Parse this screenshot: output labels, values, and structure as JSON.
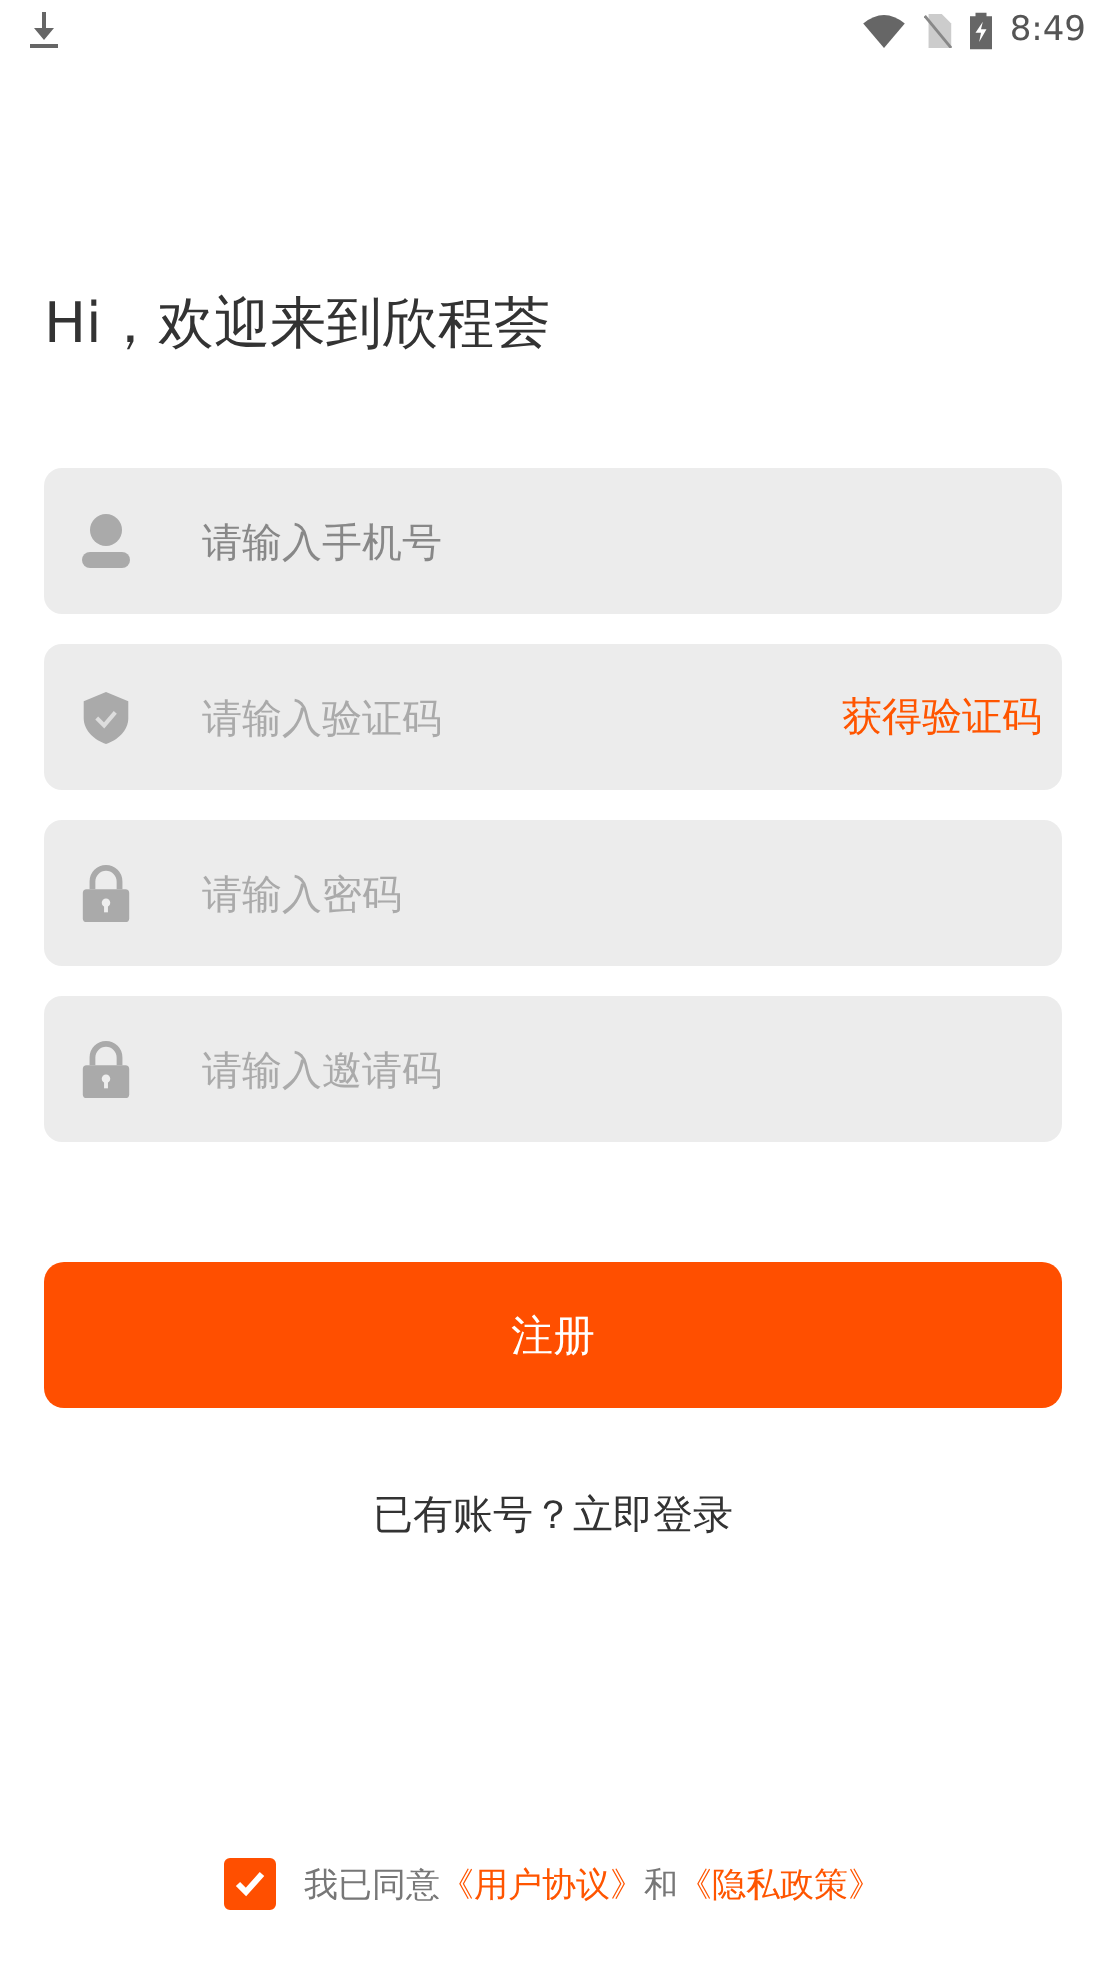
{
  "status_bar": {
    "time": "8:49"
  },
  "title": "Hi，欢迎来到欣程荟",
  "fields": [
    {
      "kind": "phone",
      "placeholder": "请输入手机号"
    },
    {
      "kind": "code",
      "placeholder": "请输入验证码",
      "action": "获得验证码"
    },
    {
      "kind": "password",
      "placeholder": "请输入密码"
    },
    {
      "kind": "invite",
      "placeholder": "请输入邀请码"
    }
  ],
  "submit": "注册",
  "login_link": "已有账号？立即登录",
  "agreement": {
    "checked": true,
    "text": "我已同意",
    "link_1": "《用户协议》",
    "joiner": "和",
    "link_2": "《隐私政策》"
  }
}
